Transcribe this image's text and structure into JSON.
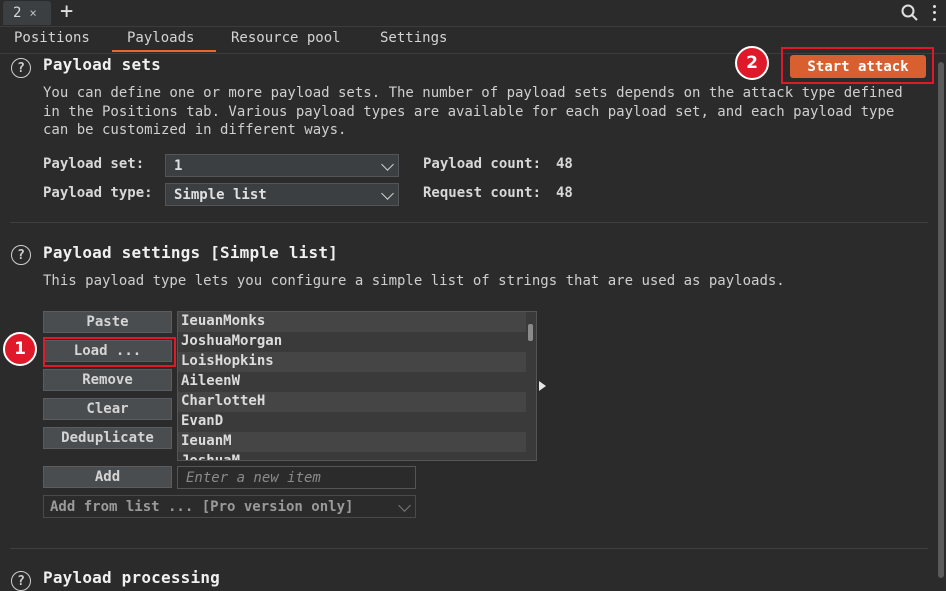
{
  "doc_tab": {
    "label": "2",
    "close": "×"
  },
  "new_tab": "+",
  "subtabs": [
    "Positions",
    "Payloads",
    "Resource pool",
    "Settings"
  ],
  "start_attack": "Start attack",
  "callouts": {
    "one": "1",
    "two": "2"
  },
  "payload_sets": {
    "title": "Payload sets",
    "description": "You can define one or more payload sets. The number of payload sets depends on the attack type defined in the Positions tab. Various payload types are available for each payload set, and each payload type can be customized in different ways.",
    "set_label": "Payload set:",
    "set_value": "1",
    "type_label": "Payload type:",
    "type_value": "Simple list",
    "count_label": "Payload count:",
    "count_value": "48",
    "request_label": "Request count:",
    "request_value": "48"
  },
  "payload_settings": {
    "title": "Payload settings [Simple list]",
    "description": "This payload type lets you configure a simple list of strings that are used as payloads.",
    "buttons": [
      "Paste",
      "Load ...",
      "Remove",
      "Clear",
      "Deduplicate"
    ],
    "items": [
      "IeuanMonks",
      "JoshuaMorgan",
      "LoisHopkins",
      "AileenW",
      "CharlotteH",
      "EvanD",
      "IeuanM",
      "JoshuaM"
    ],
    "add_label": "Add",
    "add_placeholder": "Enter a new item",
    "add_from_list": "Add from list ... [Pro version only]"
  },
  "payload_processing": {
    "title": "Payload processing"
  },
  "colors": {
    "accent": "#d86030",
    "highlight": "#e0192a"
  }
}
